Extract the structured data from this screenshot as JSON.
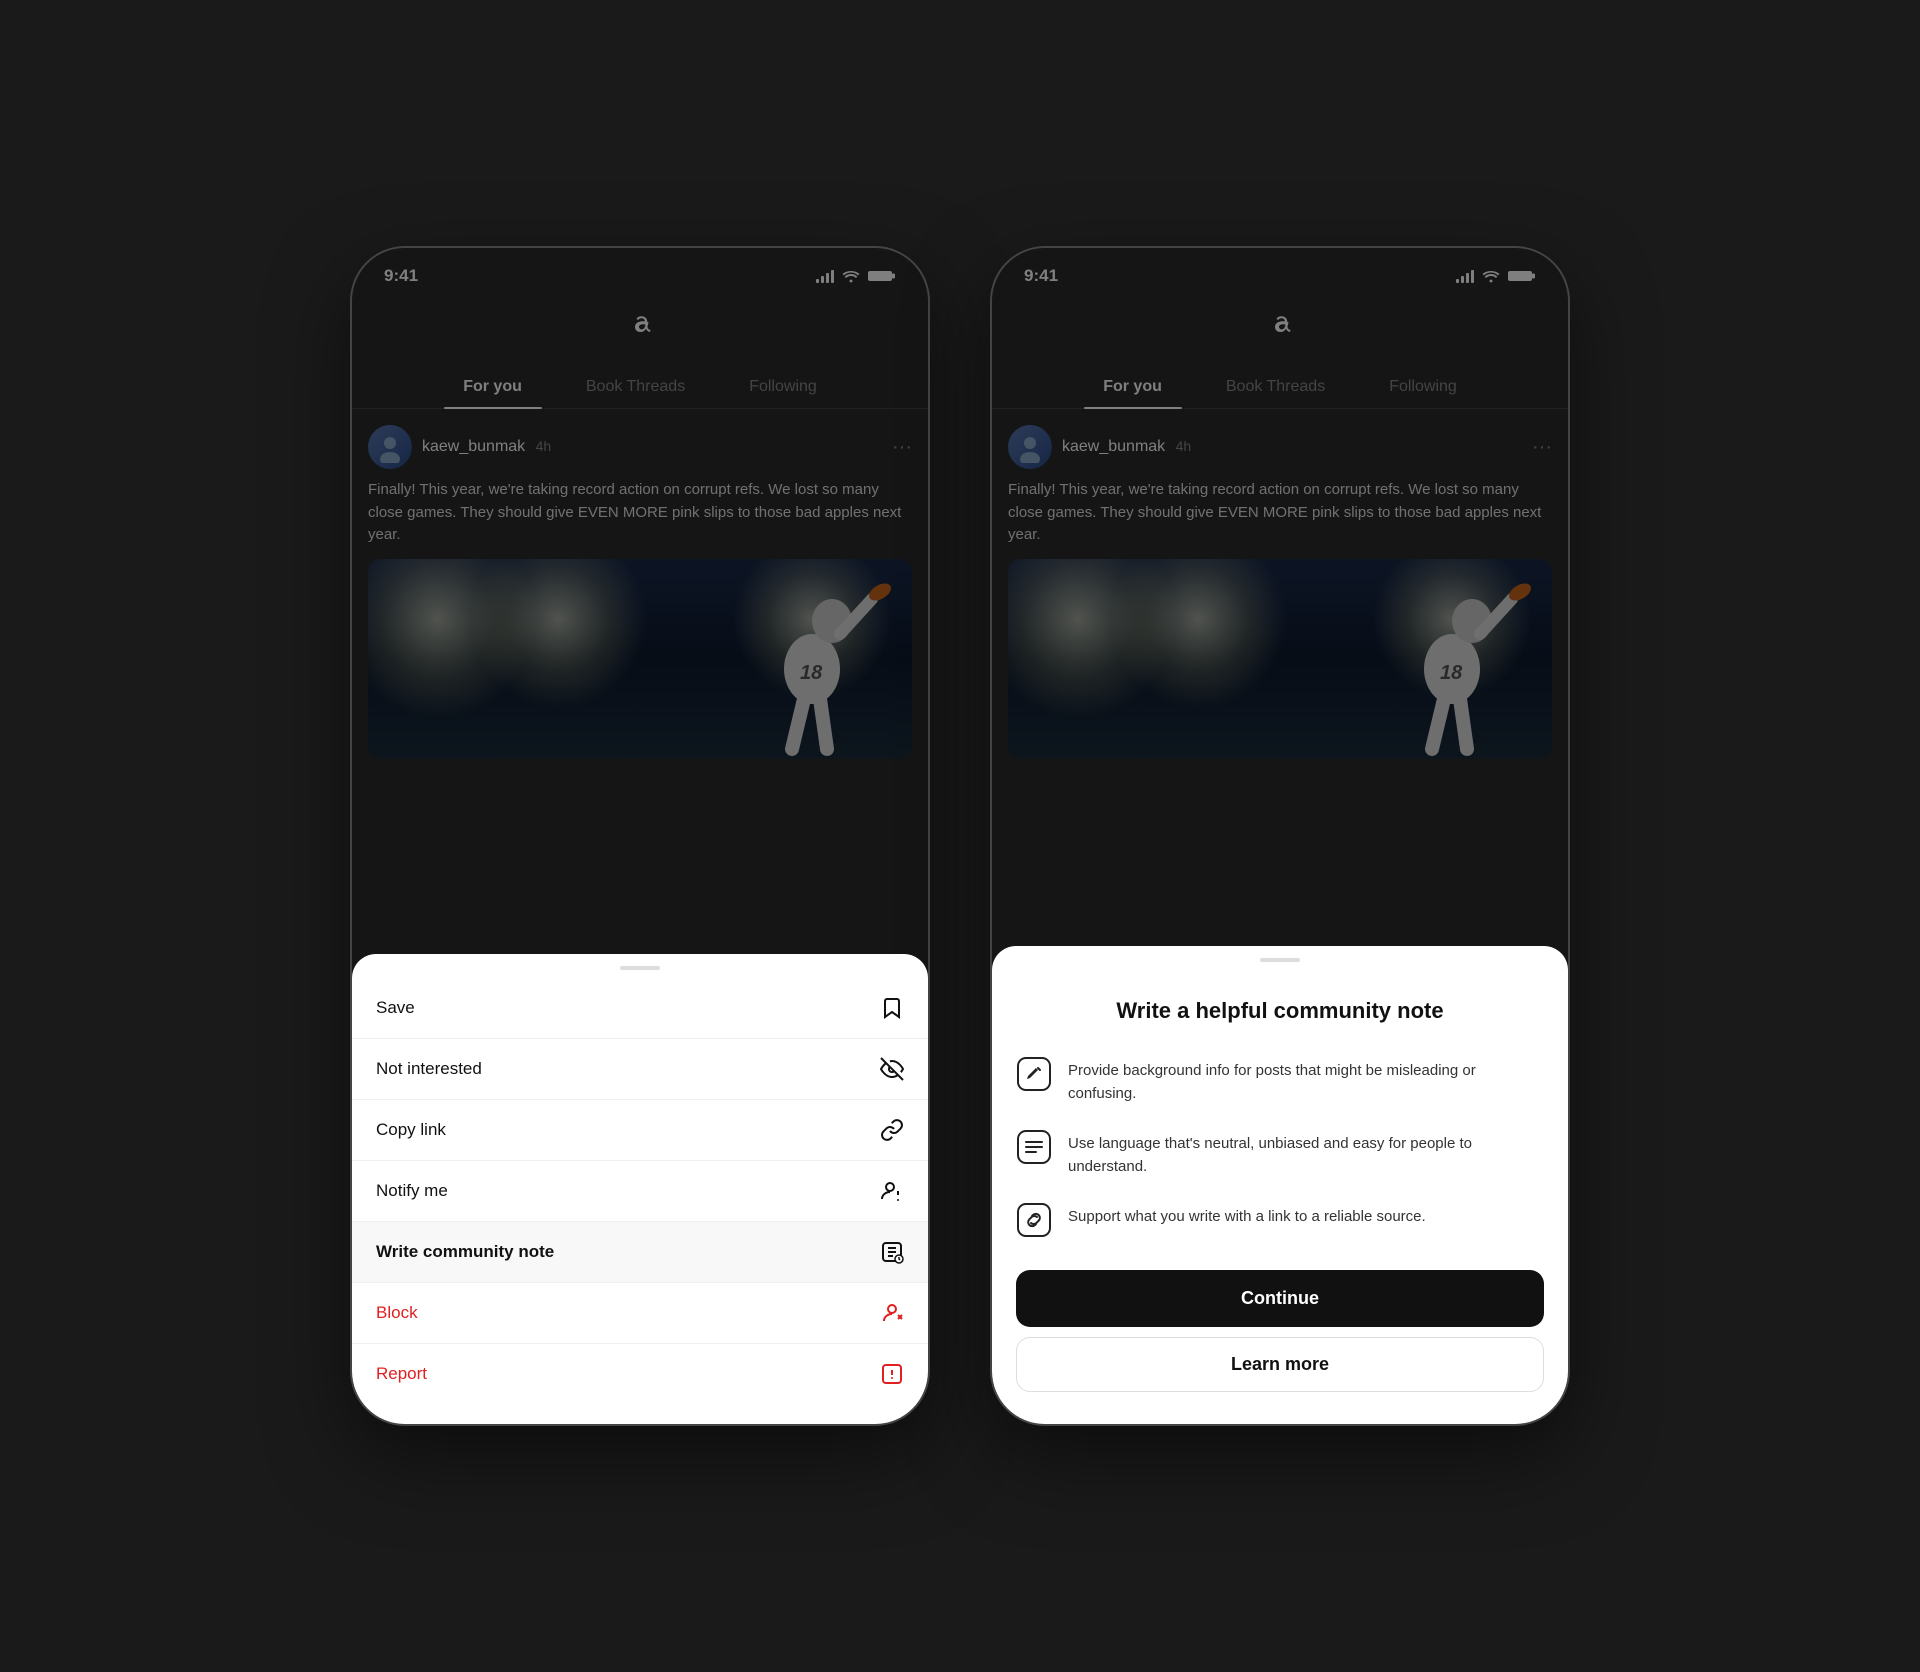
{
  "shared": {
    "time": "9:41",
    "username": "kaew_bunmak",
    "post_time": "4h",
    "post_text": "Finally! This year, we're taking record action on corrupt refs. We lost so many close games. They should give EVEN MORE pink slips to those bad apples next year.",
    "tabs": {
      "for_you": "For you",
      "book_threads": "Book Threads",
      "following": "Following"
    },
    "jersey_number": "18"
  },
  "phone1": {
    "sheet_items": [
      {
        "label": "Save",
        "icon": "bookmark"
      },
      {
        "label": "Not interested",
        "icon": "eye-off"
      },
      {
        "label": "Copy link",
        "icon": "link"
      },
      {
        "label": "Notify me",
        "icon": "person-notify"
      },
      {
        "label": "Write community note",
        "icon": "community-note"
      },
      {
        "label": "Block",
        "icon": "block",
        "red": true
      },
      {
        "label": "Report",
        "icon": "report",
        "red": true
      }
    ]
  },
  "phone2": {
    "sheet": {
      "title": "Write a helpful community note",
      "items": [
        {
          "icon": "edit-note",
          "text": "Provide background info for posts that might be misleading or confusing."
        },
        {
          "icon": "list-note",
          "text": "Use language that's neutral, unbiased and easy for people to understand."
        },
        {
          "icon": "link-note",
          "text": "Support what you write with a link to a reliable source."
        }
      ],
      "continue_btn": "Continue",
      "learn_more_btn": "Learn more"
    }
  }
}
